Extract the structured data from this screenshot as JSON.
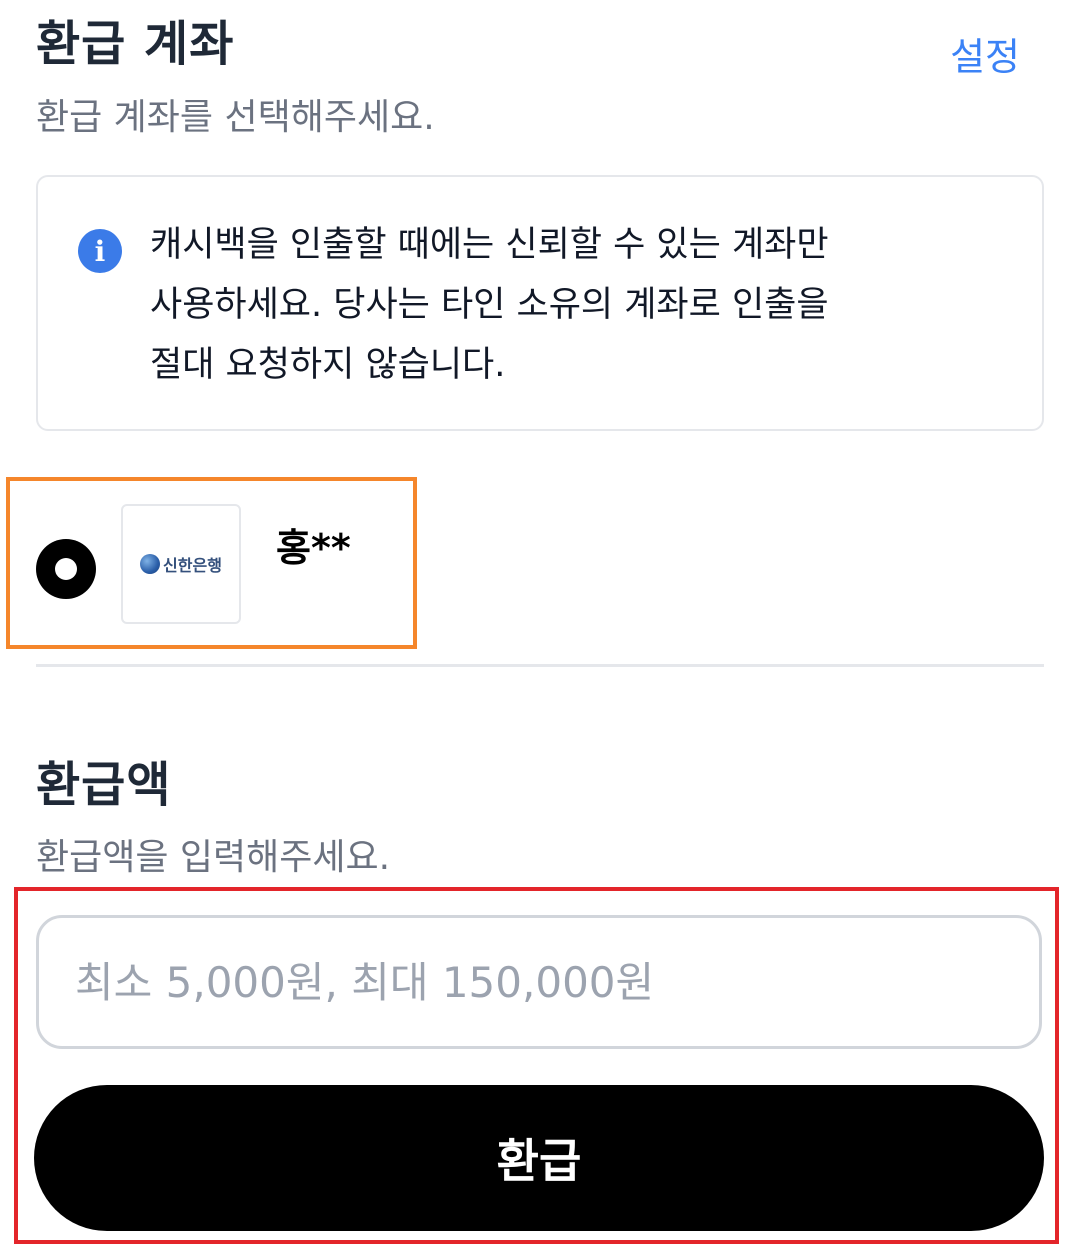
{
  "refund_account": {
    "title": "환급 계좌",
    "subtitle": "환급 계좌를 선택해주세요.",
    "settings_label": "설정"
  },
  "notice": {
    "icon": "info-icon",
    "lines": [
      "캐시백을 인출할 때에는 신뢰할 수 있는 계좌만",
      "사용하세요. 당사는 타인 소유의 계좌로 인출을",
      "절대 요청하지 않습니다."
    ]
  },
  "account": {
    "selected": true,
    "bank_name": "신한은행",
    "holder": "홍**"
  },
  "refund_amount": {
    "title": "환급액",
    "subtitle": "환급액을 입력해주세요.",
    "input_value": "",
    "placeholder": "최소 5,000원, 최대 150,000원"
  },
  "refund_button": {
    "label": "환급"
  },
  "colors": {
    "accent": "#3b82f6",
    "info_icon": "#3b7be8",
    "primary_button": "#000000",
    "highlight_account": "#f5862b",
    "highlight_action": "#e3252a"
  }
}
